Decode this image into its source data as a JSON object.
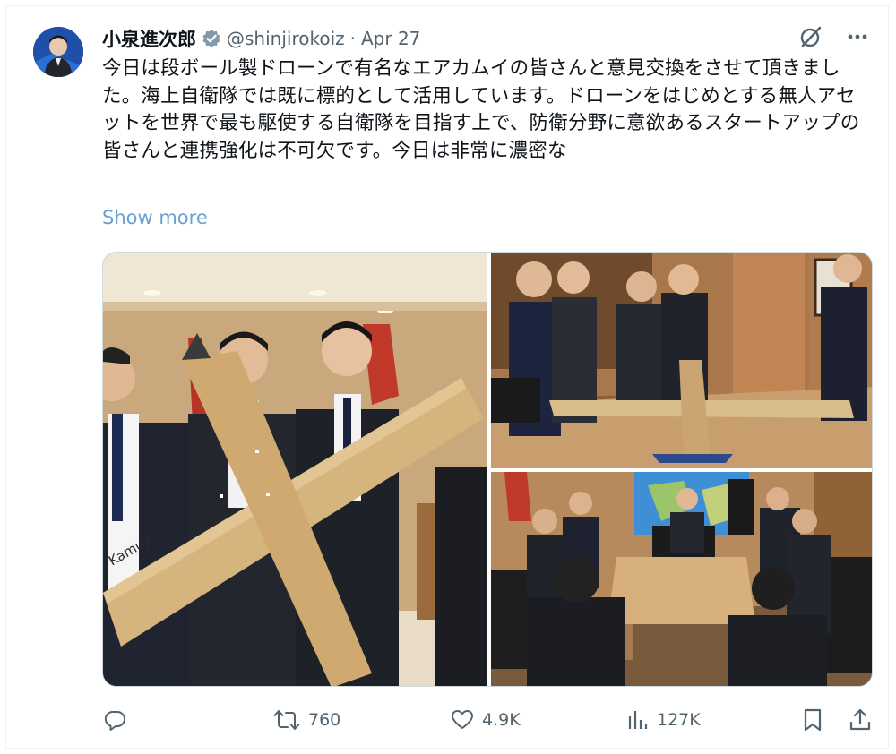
{
  "author": {
    "name": "小泉進次郎",
    "handle": "@shinjirokoiz",
    "separator": "·",
    "date": "Apr 27",
    "verified_color": "#829aab"
  },
  "tweet": {
    "text": "今日は段ボール製ドローンで有名なエアカムイの皆さんと意見交換をさせて頂きました。海上自衛隊では既に標的として活用しています。ドローンをはじめとする無人アセットを世界で最も駆使する自衛隊を目指す上で、防衛分野に意欲あるスタートアップの皆さんと連携強化は不可欠です。今日は非常に濃密な",
    "show_more_label": "Show more"
  },
  "media": {
    "photo1_label": "Kamuy"
  },
  "actions": {
    "replies": {
      "icon": "reply-icon",
      "count": ""
    },
    "reposts": {
      "icon": "repost-icon",
      "count": "760"
    },
    "likes": {
      "icon": "heart-icon",
      "count": "4.9K"
    },
    "views": {
      "icon": "views-icon",
      "count": "127K"
    },
    "bookmark": {
      "icon": "bookmark-icon"
    },
    "share": {
      "icon": "share-icon"
    }
  },
  "colors": {
    "text": "#0f1419",
    "secondary": "#536471",
    "link": "#6b9fd6"
  }
}
